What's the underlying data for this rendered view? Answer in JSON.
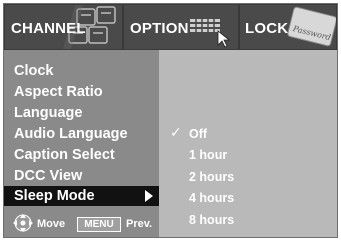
{
  "tabs": [
    {
      "label": "CHANNEL",
      "icon": "channel-grid-icon"
    },
    {
      "label": "OPTION",
      "icon": "keyboard-cursor-icon"
    },
    {
      "label": "LOCK",
      "icon": "password-card-icon",
      "icon_text": "Password"
    }
  ],
  "menu_items": [
    {
      "label": "Clock"
    },
    {
      "label": "Aspect Ratio"
    },
    {
      "label": "Language"
    },
    {
      "label": "Audio Language"
    },
    {
      "label": "Caption Select"
    },
    {
      "label": "DCC View"
    },
    {
      "label": "Sleep Mode",
      "selected": true
    }
  ],
  "options": [
    {
      "label": "Off",
      "checked": true
    },
    {
      "label": "1 hour"
    },
    {
      "label": "2 hours"
    },
    {
      "label": "4 hours"
    },
    {
      "label": "8 hours"
    }
  ],
  "hint": {
    "move_label": "Move",
    "menu_button_label": "MENU",
    "prev_label": "Prev."
  },
  "colors": {
    "tab_bar": "#3a3a3a",
    "left_panel": "#8a8a8a",
    "right_panel": "#b9b9b9",
    "selected_row": "#111111",
    "text": "#ffffff"
  }
}
